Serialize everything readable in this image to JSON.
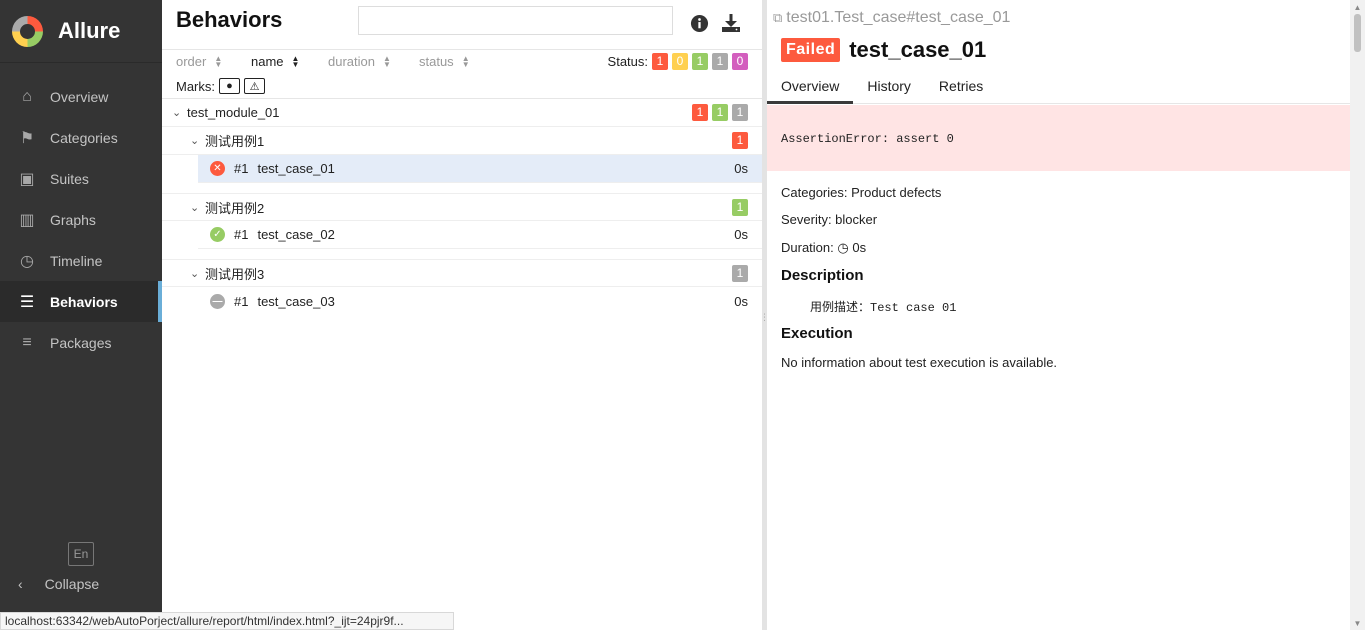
{
  "app": {
    "name": "Allure"
  },
  "nav": [
    {
      "label": "Overview",
      "icon": "home-icon",
      "glyph": "⌂"
    },
    {
      "label": "Categories",
      "icon": "flag-icon",
      "glyph": "⚑"
    },
    {
      "label": "Suites",
      "icon": "briefcase-icon",
      "glyph": "▣"
    },
    {
      "label": "Graphs",
      "icon": "bar-chart-icon",
      "glyph": "▥"
    },
    {
      "label": "Timeline",
      "icon": "clock-icon",
      "glyph": "◷"
    },
    {
      "label": "Behaviors",
      "icon": "list-icon",
      "glyph": "☰",
      "active": true
    },
    {
      "label": "Packages",
      "icon": "align-left-icon",
      "glyph": "≡"
    }
  ],
  "sidebar": {
    "lang": "En",
    "collapse": "Collapse"
  },
  "behaviors": {
    "title": "Behaviors",
    "search_placeholder": "",
    "sort": {
      "order": "order",
      "name": "name",
      "duration": "duration",
      "status": "status"
    },
    "status_label": "Status:",
    "status_counts": {
      "failed": "1",
      "broken": "0",
      "passed": "1",
      "skipped": "1",
      "unknown": "0"
    },
    "marks_label": "Marks:",
    "module": {
      "name": "test_module_01",
      "counts": {
        "failed": "1",
        "passed": "1",
        "skipped": "1"
      }
    },
    "groups": [
      {
        "name": "测试用例1",
        "count": "1",
        "status": "failed",
        "tests": [
          {
            "num": "#1",
            "name": "test_case_01",
            "duration": "0s",
            "status": "failed"
          }
        ]
      },
      {
        "name": "测试用例2",
        "count": "1",
        "status": "passed",
        "tests": [
          {
            "num": "#1",
            "name": "test_case_02",
            "duration": "0s",
            "status": "passed"
          }
        ]
      },
      {
        "name": "测试用例3",
        "count": "1",
        "status": "skipped",
        "tests": [
          {
            "num": "#1",
            "name": "test_case_03",
            "duration": "0s",
            "status": "skipped"
          }
        ]
      }
    ]
  },
  "detail": {
    "breadcrumb": "test01.Test_case#test_case_01",
    "status_label": "Failed",
    "title": "test_case_01",
    "tabs": [
      "Overview",
      "History",
      "Retries"
    ],
    "error": "AssertionError: assert 0",
    "categories": "Categories: Product defects",
    "severity": "Severity: blocker",
    "duration_label": "Duration:",
    "duration_value": "0s",
    "description_heading": "Description",
    "description_text": "用例描述：Test case 01",
    "execution_heading": "Execution",
    "execution_text": "No information about test execution is available."
  },
  "statusbar": {
    "url": "localhost:63342/webAutoPorject/allure/report/html/index.html?_ijt=24pjr9f..."
  },
  "colors": {
    "failed": "#fd5a3e",
    "broken": "#ffd050",
    "passed": "#97cc64",
    "skipped": "#aaaaaa",
    "unknown": "#d35ebe",
    "sidebar": "#343434"
  }
}
